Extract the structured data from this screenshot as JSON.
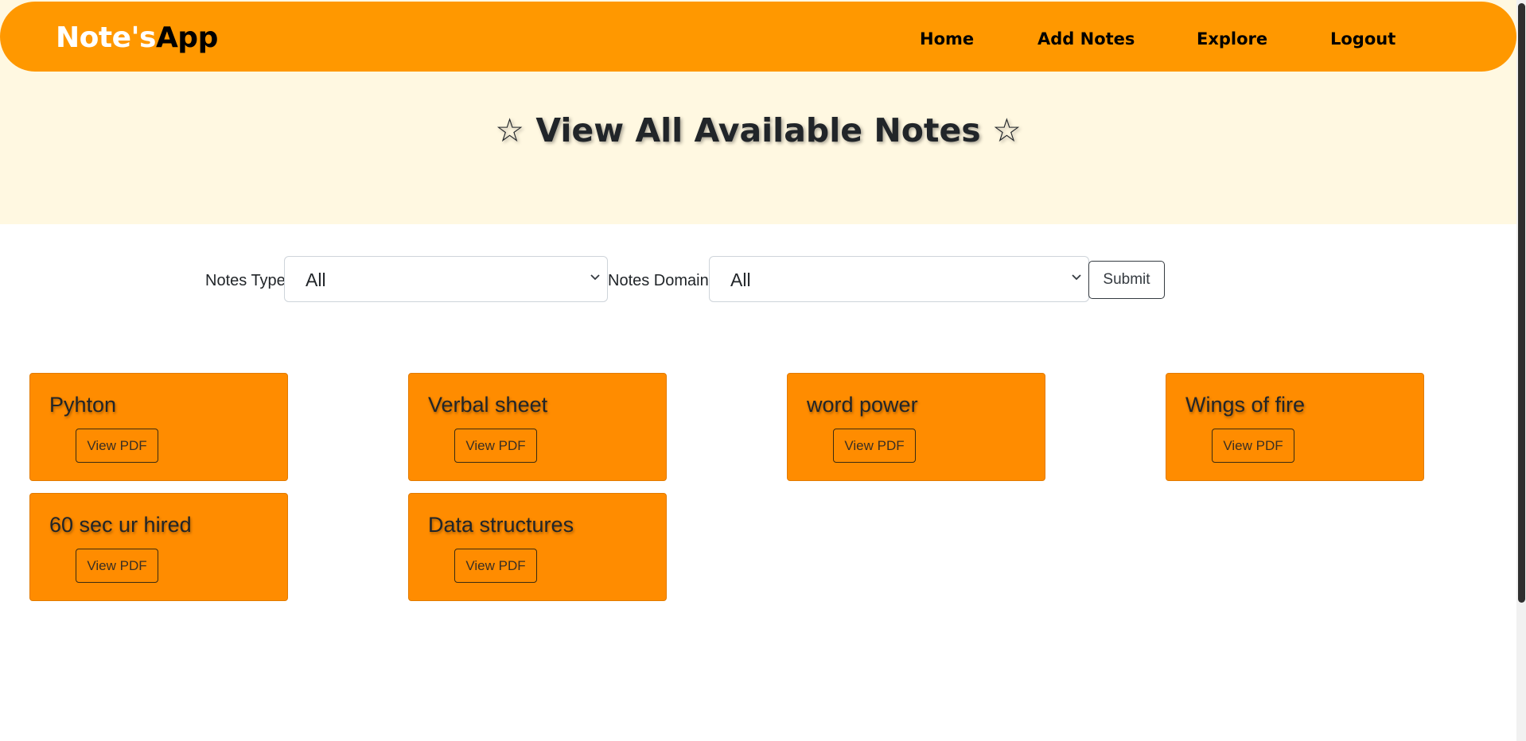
{
  "navbar": {
    "brand_part1": "Note's",
    "brand_part2": "App",
    "links": [
      "Home",
      "Add Notes",
      "Explore",
      "Logout"
    ]
  },
  "hero": {
    "title": "☆ View All Available Notes ☆"
  },
  "filters": {
    "type_label": "Notes Type",
    "type_value": "All",
    "domain_label": "Notes Domain",
    "domain_value": "All",
    "submit_label": "Submit"
  },
  "notes": [
    {
      "title": "Pyhton",
      "button": "View PDF"
    },
    {
      "title": "Verbal sheet",
      "button": "View PDF"
    },
    {
      "title": "word power",
      "button": "View PDF"
    },
    {
      "title": "Wings of fire",
      "button": "View PDF"
    },
    {
      "title": "60 sec ur hired",
      "button": "View PDF"
    },
    {
      "title": "Data structures",
      "button": "View PDF"
    }
  ],
  "colors": {
    "accent": "#ff9800",
    "card": "#ff8c00",
    "hero_bg": "#fff8e1"
  }
}
